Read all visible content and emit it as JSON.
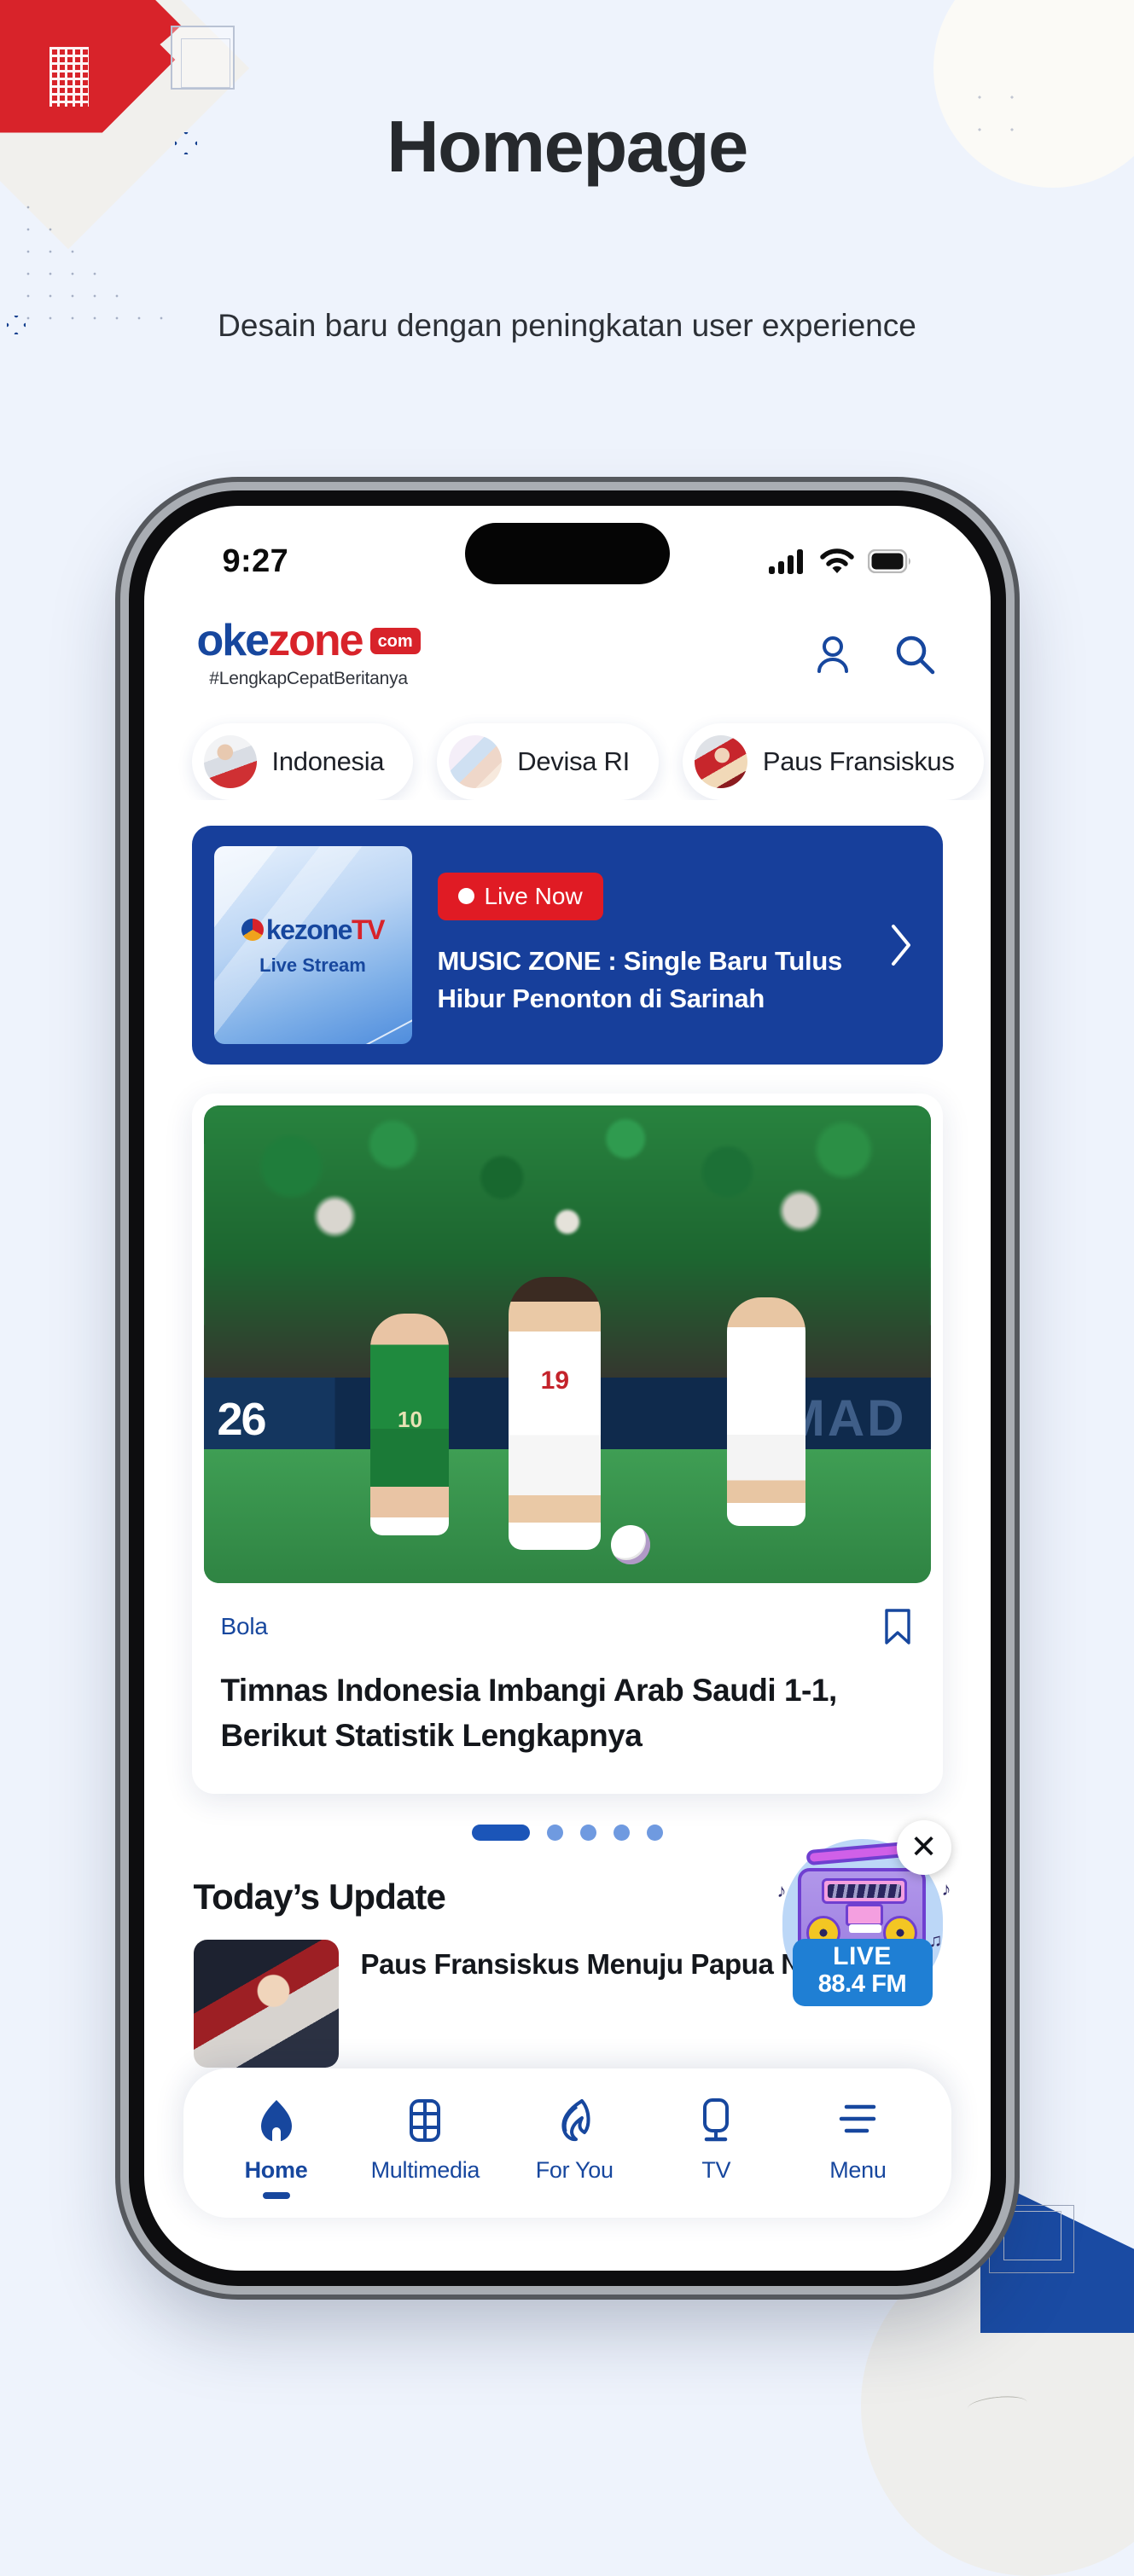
{
  "page": {
    "title": "Homepage",
    "subtitle": "Desain baru dengan peningkatan user experience"
  },
  "colors": {
    "background": "#eef3fc",
    "brand_blue": "#17479e",
    "brand_red": "#d8232a",
    "accent_blue": "#1b55b8",
    "live_red": "#e01b24",
    "banner_blue": "#173f9b"
  },
  "phone": {
    "status_bar": {
      "time": "9:27",
      "icons": [
        "cellular-signal-icon",
        "wifi-icon",
        "battery-icon"
      ]
    },
    "app_header": {
      "logo_part_one": "oke",
      "logo_part_two": "zone",
      "logo_suffix": "com",
      "tagline": "#LengkapCepatBeritanya",
      "actions": [
        {
          "name": "profile-icon",
          "label": "Profile"
        },
        {
          "name": "search-icon",
          "label": "Search"
        }
      ]
    },
    "chips": [
      {
        "label": "Indonesia"
      },
      {
        "label": "Devisa RI"
      },
      {
        "label": "Paus Fransiskus"
      }
    ],
    "live_banner": {
      "thumb_logo_blue": "kezone",
      "thumb_logo_red": "TV",
      "thumb_subtitle": "Live Stream",
      "badge": "Live Now",
      "title": "MUSIC ZONE : Single Baru Tulus Hibur Penonton di Sarinah",
      "chevron": "chevron-right-icon"
    },
    "news_card": {
      "category": "Bola",
      "bookmark_icon": "bookmark-icon",
      "headline": "Timnas Indonesia Imbangi Arab Saudi 1-1, Berikut Statistik Lengkapnya",
      "photo_alt_score": "26",
      "photo_alt_board": "MAD",
      "player_green_number": "10",
      "player_white_number": "19"
    },
    "carousel": {
      "total_dots": 5,
      "active_index": 0
    },
    "today_section": {
      "title": "Today’s Update",
      "items": [
        {
          "headline": "Paus Fransiskus Menuju Papua Nugini"
        }
      ]
    },
    "radio_widget": {
      "live_text": "LIVE",
      "frequency": "88.4 FM",
      "close_icon": "close-icon"
    },
    "bottom_nav": {
      "items": [
        {
          "label": "Home",
          "icon": "home-icon",
          "active": true
        },
        {
          "label": "Multimedia",
          "icon": "film-icon",
          "active": false
        },
        {
          "label": "For You",
          "icon": "flame-icon",
          "active": false
        },
        {
          "label": "TV",
          "icon": "television-icon",
          "active": false
        },
        {
          "label": "Menu",
          "icon": "menu-icon",
          "active": false
        }
      ]
    }
  }
}
